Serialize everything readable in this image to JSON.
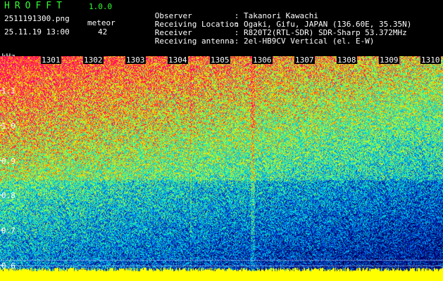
{
  "app": {
    "title": "HROFFT",
    "version": "1.0.0"
  },
  "file_name": "2511191300.png",
  "meteor": {
    "label": "meteor",
    "count": "42"
  },
  "date_time": "25.11.19 13:00",
  "metadata": [
    {
      "key": "Observer",
      "value": "Takanori Kawachi"
    },
    {
      "key": "Receiving Location",
      "value": "Ogaki, Gifu, JAPAN (136.60E, 35.35N)"
    },
    {
      "key": "Receiver",
      "value": "R820T2(RTL-SDR) SDR-Sharp 53.372MHz"
    },
    {
      "key": "Receiving antenna",
      "value": "2el-HB9CV Vertical (el. E-W)"
    }
  ],
  "separator": ":",
  "axis": {
    "unit": "kHz",
    "time_ticks": [
      "1301",
      "1302",
      "1303",
      "1304",
      "1305",
      "1306",
      "1307",
      "1308",
      "1309",
      "1310"
    ],
    "freq_ticks": [
      "1.1",
      "1.0",
      "0.9",
      "0.8",
      "0.7",
      "0.6"
    ]
  },
  "colors": {
    "label_green": "#33ff33",
    "text_white": "#ffffff",
    "signal_yellow": "#ffff00"
  }
}
